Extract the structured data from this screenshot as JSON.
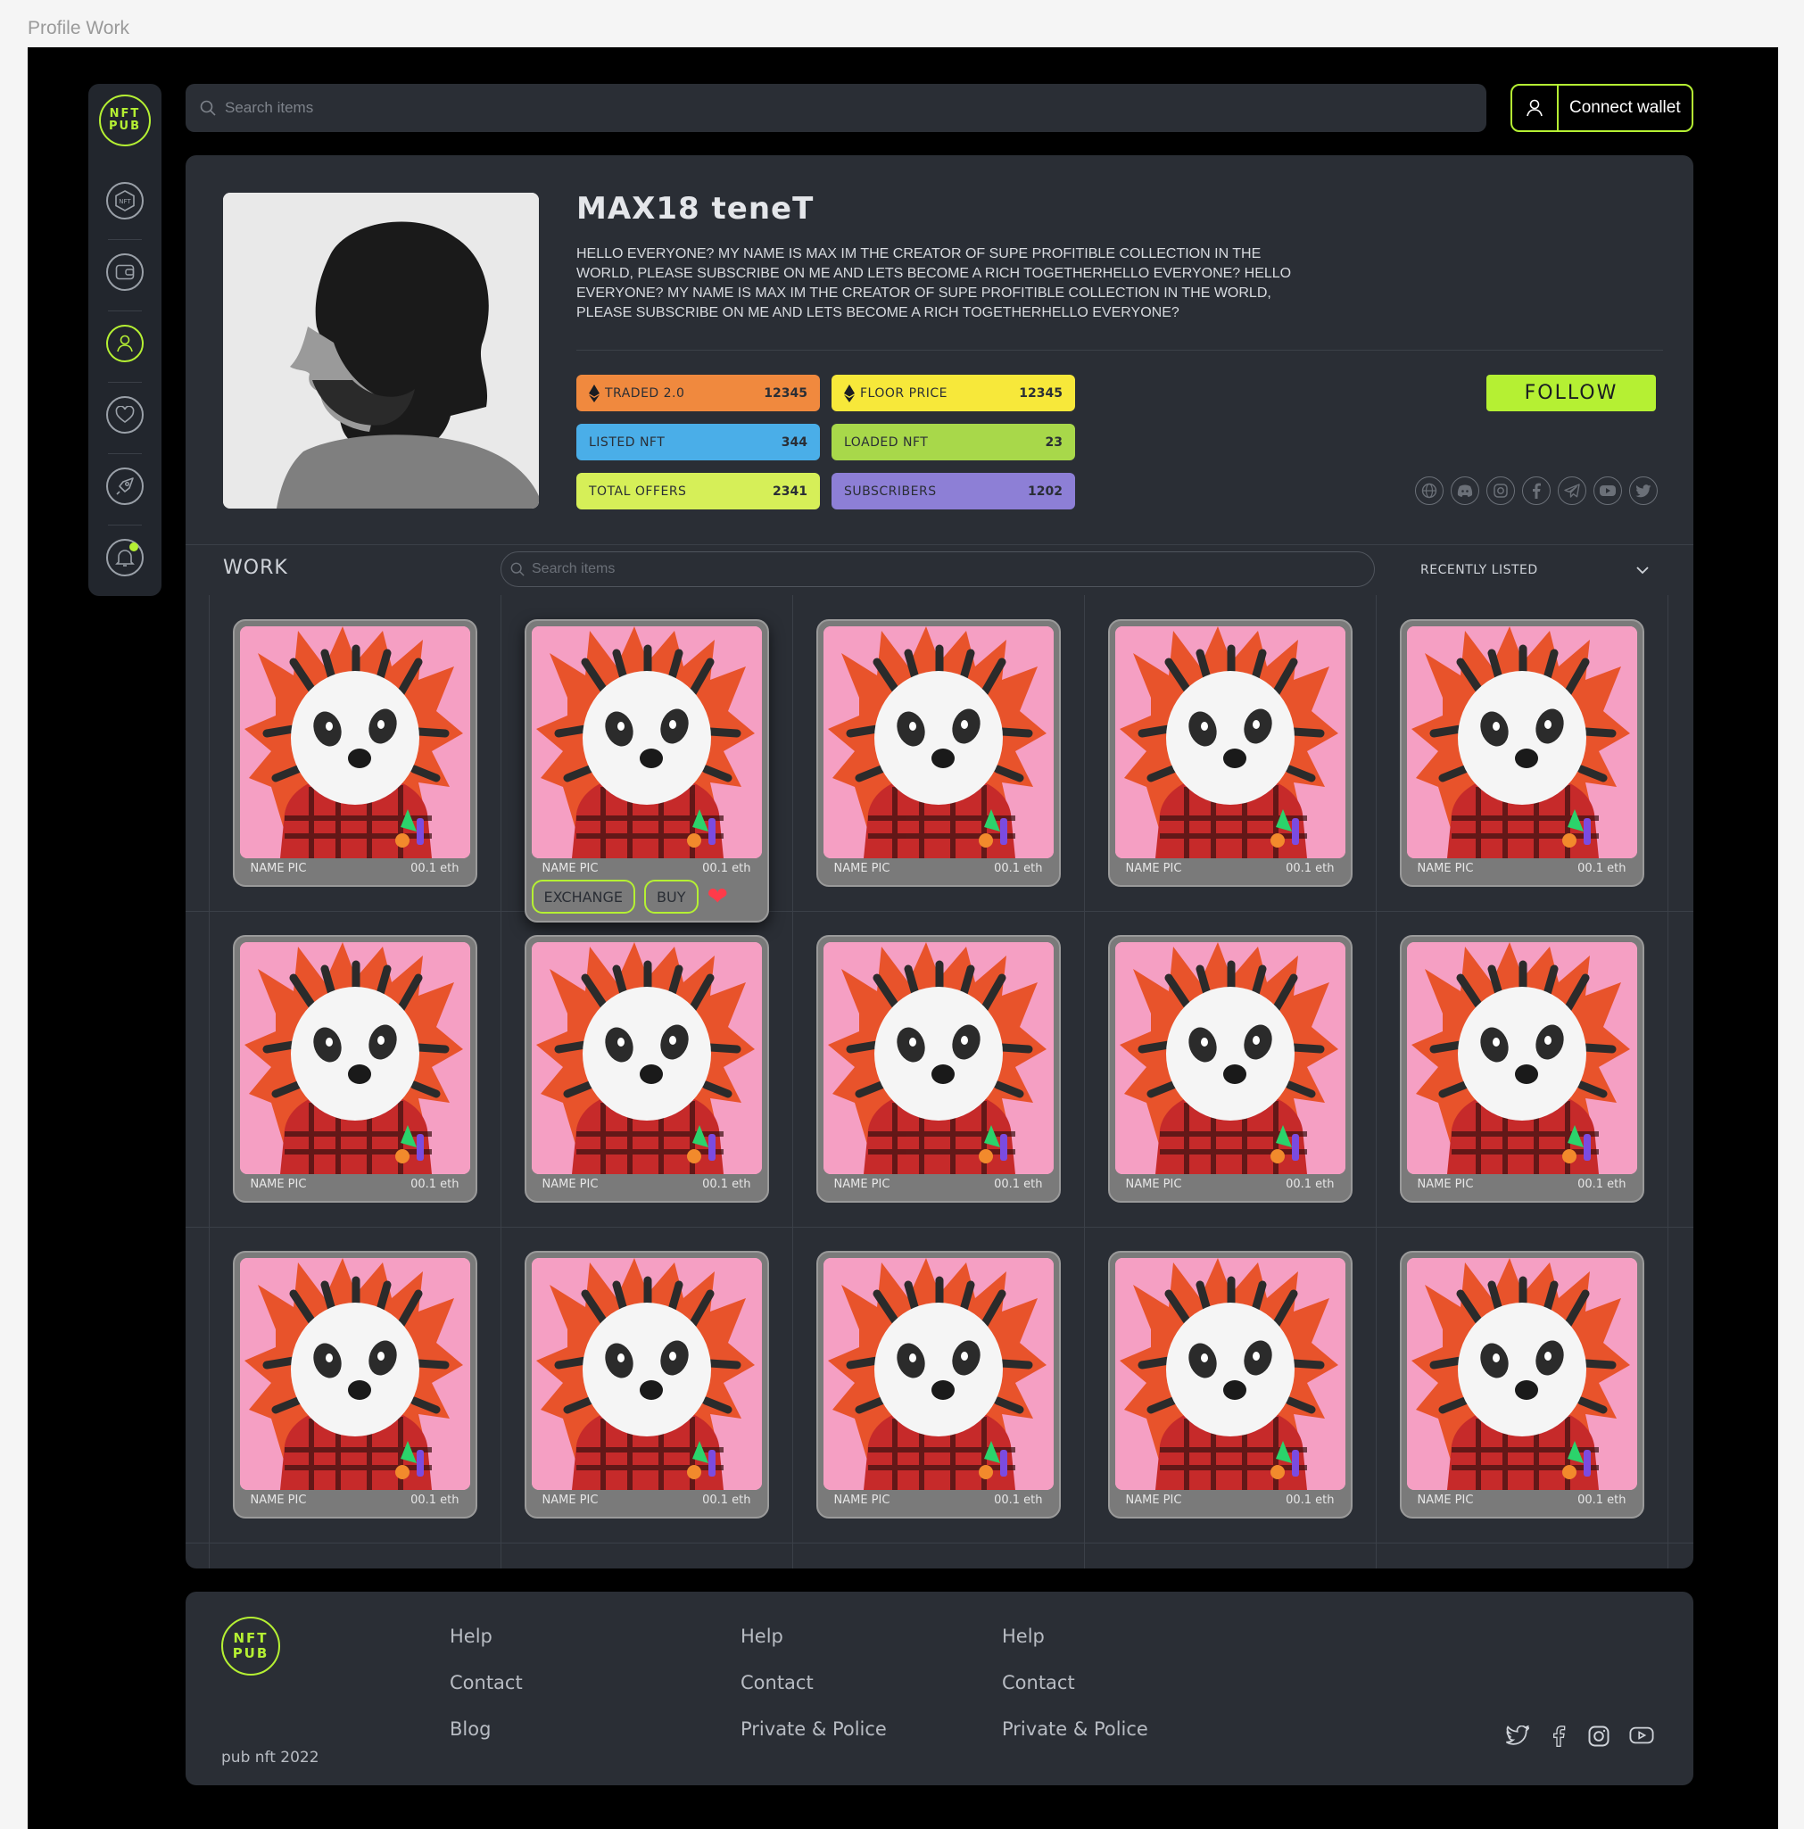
{
  "frame_title": "Profile Work",
  "brand": {
    "logo_top": "NFT",
    "logo_bottom": "PUB",
    "accent": "#b5f033"
  },
  "sidebar": {
    "items": [
      {
        "icon": "nft-hexagon-icon",
        "label": "NFT"
      },
      {
        "icon": "wallet-icon"
      },
      {
        "icon": "user-icon",
        "active": true
      },
      {
        "icon": "heart-icon"
      },
      {
        "icon": "rocket-icon"
      },
      {
        "icon": "bell-icon",
        "notification": true
      }
    ]
  },
  "header": {
    "search_placeholder": "Search items",
    "wallet_label": "Connect wallet"
  },
  "profile": {
    "name": "MAX18 teneT",
    "bio": "HELLO EVERYONE? MY NAME IS MAX IM THE CREATOR  OF SUPE  PROFITIBLE COLLECTION IN THE WORLD, PLEASE SUBSCRIBE ON ME  AND LETS BECOME A RICH TOGETHERHELLO EVERYONE? HELLO EVERYONE? MY NAME IS MAX IM THE CREATOR  OF SUPE  PROFITIBLE COLLECTION IN THE WORLD, PLEASE SUBSCRIBE ON ME  AND LETS BECOME A RICH TOGETHERHELLO EVERYONE?",
    "follow_label": "FOLLOW",
    "stats": [
      {
        "label": "TRADED 2.0",
        "value": "12345",
        "eth": true,
        "color": "#f0893e"
      },
      {
        "label": "FLOOR PRICE",
        "value": "12345",
        "eth": true,
        "color": "#f7e83a"
      },
      {
        "label": "LISTED NFT",
        "value": "344",
        "eth": false,
        "color": "#4aaee8"
      },
      {
        "label": "LOADED NFT",
        "value": "23",
        "eth": false,
        "color": "#a8d84a"
      },
      {
        "label": "TOTAL OFFERS",
        "value": "2341",
        "eth": false,
        "color": "#d6ef58"
      },
      {
        "label": "SUBSCRIBERS",
        "value": "1202",
        "eth": false,
        "color": "#8d7fd6"
      }
    ],
    "socials": [
      "globe-icon",
      "discord-icon",
      "instagram-icon",
      "facebook-icon",
      "telegram-icon",
      "youtube-icon",
      "twitter-icon"
    ]
  },
  "work": {
    "title": "WORK",
    "search_placeholder": "Search items",
    "sort_label": "RECENTLY LISTED",
    "card_name": "NAME PIC",
    "card_price": "00.1 eth",
    "exchange_label": "EXCHANGE",
    "buy_label": "BUY",
    "rows": 3,
    "cols": 5,
    "hovered_card": 1
  },
  "footer": {
    "columns": [
      [
        "Help",
        "Contact",
        "Blog"
      ],
      [
        "Help",
        "Contact",
        "Private & Police"
      ],
      [
        "Help",
        "Contact",
        "Private & Police"
      ]
    ],
    "copyright": "pub nft 2022",
    "socials": [
      "twitter-icon",
      "facebook-icon",
      "instagram-icon",
      "youtube-icon"
    ]
  }
}
